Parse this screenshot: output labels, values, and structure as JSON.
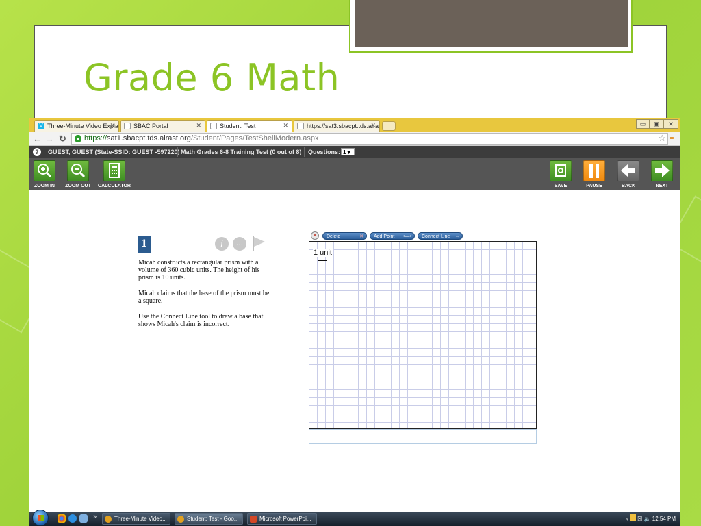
{
  "slide": {
    "title": "Grade 6 Math"
  },
  "browser": {
    "tabs": [
      {
        "label": "Three-Minute Video Expla",
        "icon": "vimeo-icon"
      },
      {
        "label": "SBAC Portal",
        "icon": "page-icon"
      },
      {
        "label": "Student: Test",
        "icon": "page-icon"
      },
      {
        "label": "https://sat3.sbacpt.tds.airas",
        "icon": "page-icon"
      }
    ],
    "url_https": "https://",
    "url_host": "sat1.sbacpt.tds.airast.org",
    "url_path": "/Student/Pages/TestShellModern.aspx",
    "window_controls": [
      "▭",
      "▣",
      "✕"
    ]
  },
  "test": {
    "student": "GUEST, GUEST (State-SSID: GUEST -597220)",
    "test_name": "Math Grades 6-8 Training Test (0 out of 8)",
    "questions_label": "Questions:",
    "question_selected": "1",
    "toolbar_left": [
      {
        "label": "ZOOM IN",
        "icon": "zoom-in-icon"
      },
      {
        "label": "ZOOM OUT",
        "icon": "zoom-out-icon"
      },
      {
        "label": "CALCULATOR",
        "icon": "calculator-icon"
      }
    ],
    "toolbar_right": [
      {
        "label": "SAVE",
        "icon": "save-icon"
      },
      {
        "label": "PAUSE",
        "icon": "pause-icon"
      },
      {
        "label": "BACK",
        "icon": "back-arrow-icon"
      },
      {
        "label": "NEXT",
        "icon": "next-arrow-icon"
      }
    ]
  },
  "question": {
    "number": "1",
    "paragraphs": [
      "Micah constructs a rectangular prism with a volume of 360 cubic units. The height of his prism is 10 units.",
      "Micah claims that the base of the prism must be a square.",
      "Use the Connect Line tool to draw a base that shows Micah's claim is incorrect."
    ]
  },
  "grid_tool": {
    "delete_label": "Delete",
    "add_point_label": "Add Point",
    "connect_line_label": "Connect Line",
    "unit_label": "1 unit"
  },
  "taskbar": {
    "items": [
      {
        "label": "Three-Minute Video..."
      },
      {
        "label": "Student: Test - Goo..."
      },
      {
        "label": "Microsoft PowerPoi..."
      }
    ],
    "overflow": "»",
    "clock": "12:54 PM"
  }
}
